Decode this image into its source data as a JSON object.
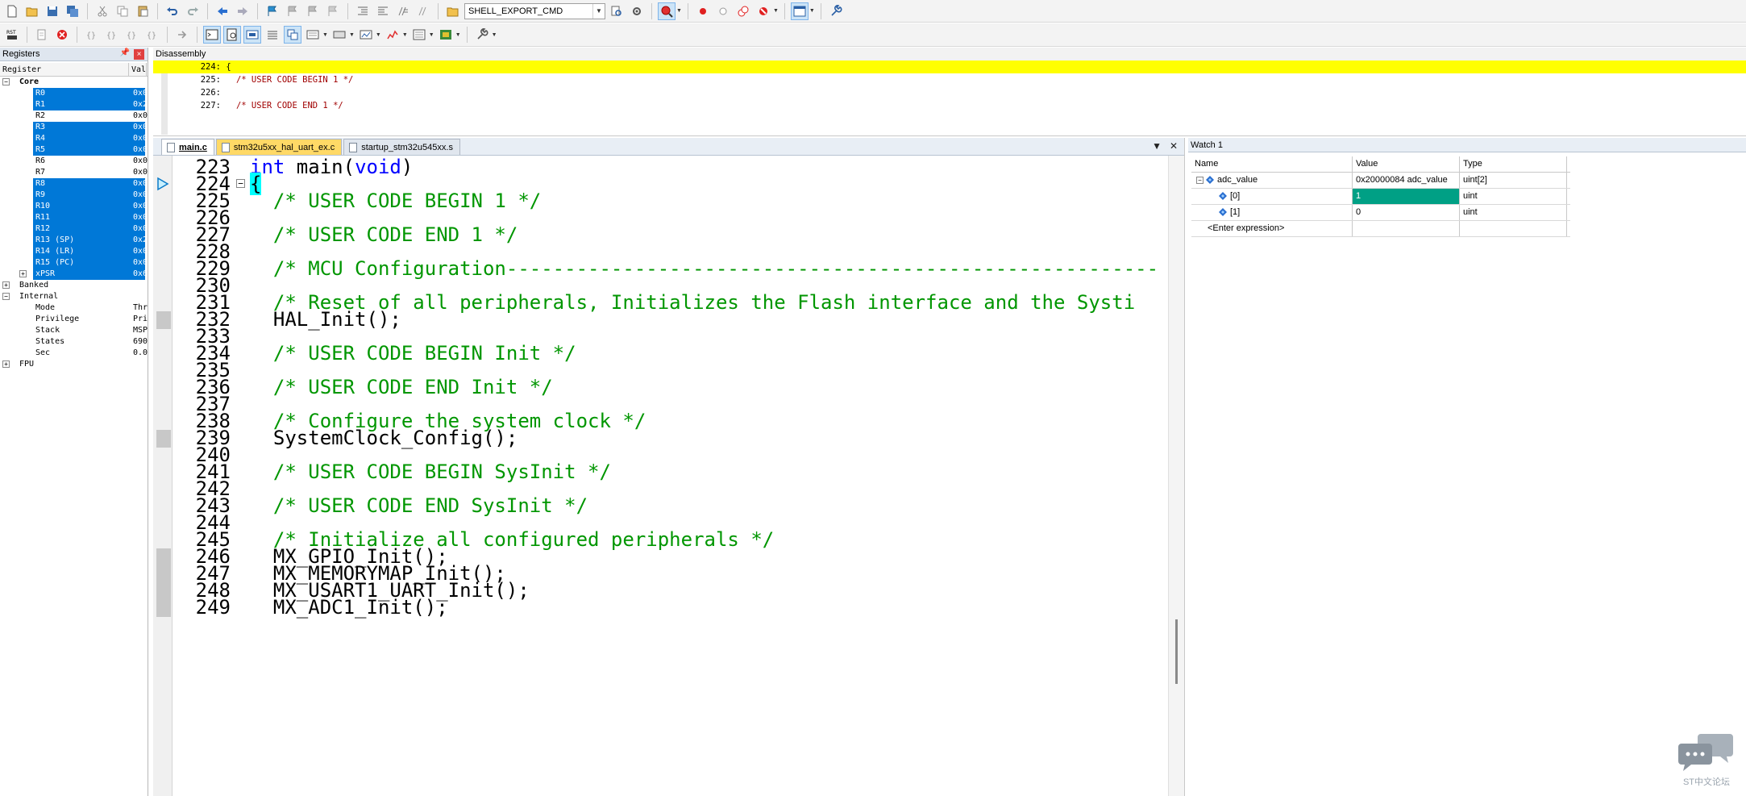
{
  "toolbar": {
    "target_combo": "SHELL_EXPORT_CMD"
  },
  "registers": {
    "title": "Registers",
    "close": "×",
    "col_register": "Register",
    "col_value": "Val",
    "rows": [
      {
        "name": "Core",
        "value": "",
        "indent": 1,
        "expand": "⊟",
        "bold": true,
        "sel": false
      },
      {
        "name": "R0",
        "value": "0x0",
        "indent": 3,
        "sel": true
      },
      {
        "name": "R1",
        "value": "0x2",
        "indent": 3,
        "sel": true
      },
      {
        "name": "R2",
        "value": "0x0",
        "indent": 3,
        "sel": false
      },
      {
        "name": "R3",
        "value": "0x0",
        "indent": 3,
        "sel": true
      },
      {
        "name": "R4",
        "value": "0x0",
        "indent": 3,
        "sel": true
      },
      {
        "name": "R5",
        "value": "0x0",
        "indent": 3,
        "sel": true
      },
      {
        "name": "R6",
        "value": "0x0",
        "indent": 3,
        "sel": false
      },
      {
        "name": "R7",
        "value": "0x0",
        "indent": 3,
        "sel": false
      },
      {
        "name": "R8",
        "value": "0x0",
        "indent": 3,
        "sel": true
      },
      {
        "name": "R9",
        "value": "0x0",
        "indent": 3,
        "sel": true
      },
      {
        "name": "R10",
        "value": "0x0",
        "indent": 3,
        "sel": true
      },
      {
        "name": "R11",
        "value": "0x0",
        "indent": 3,
        "sel": true
      },
      {
        "name": "R12",
        "value": "0x0",
        "indent": 3,
        "sel": true
      },
      {
        "name": "R13 (SP)",
        "value": "0x2",
        "indent": 3,
        "sel": true
      },
      {
        "name": "R14 (LR)",
        "value": "0x0",
        "indent": 3,
        "sel": true
      },
      {
        "name": "R15 (PC)",
        "value": "0x0",
        "indent": 3,
        "sel": true
      },
      {
        "name": "xPSR",
        "value": "0x6",
        "indent": 3,
        "expand": "⊞",
        "sel": true
      },
      {
        "name": "Banked",
        "value": "",
        "indent": 1,
        "expand": "⊞",
        "sel": false
      },
      {
        "name": "Internal",
        "value": "",
        "indent": 1,
        "expand": "⊟",
        "sel": false
      },
      {
        "name": "Mode",
        "value": "Thr",
        "indent": 3,
        "sel": false
      },
      {
        "name": "Privilege",
        "value": "Pri",
        "indent": 3,
        "sel": false
      },
      {
        "name": "Stack",
        "value": "MSP",
        "indent": 3,
        "sel": false
      },
      {
        "name": "States",
        "value": "690",
        "indent": 3,
        "sel": false
      },
      {
        "name": "Sec",
        "value": "0.0",
        "indent": 3,
        "sel": false
      },
      {
        "name": "FPU",
        "value": "",
        "indent": 1,
        "expand": "⊞",
        "sel": false
      }
    ]
  },
  "disassembly": {
    "title": "Disassembly",
    "lines": [
      {
        "num": "224:",
        "text": " {",
        "current": true,
        "comment": false
      },
      {
        "num": "225:",
        "text": "   /* USER CODE BEGIN 1 */",
        "current": false,
        "comment": true
      },
      {
        "num": "226:",
        "text": "",
        "current": false,
        "comment": false
      },
      {
        "num": "227:",
        "text": "   /* USER CODE END 1 */",
        "current": false,
        "comment": true
      }
    ]
  },
  "editor": {
    "tabs": [
      {
        "label": "main.c",
        "active": true,
        "modified": false
      },
      {
        "label": "stm32u5xx_hal_uart_ex.c",
        "active": false,
        "modified": true
      },
      {
        "label": "startup_stm32u545xx.s",
        "active": false,
        "modified": false
      }
    ],
    "lines": [
      {
        "ln": "223",
        "text": "int main(void)",
        "type": "main"
      },
      {
        "ln": "224",
        "text": "{",
        "type": "brace"
      },
      {
        "ln": "225",
        "text": "  /* USER CODE BEGIN 1 */",
        "type": "comment"
      },
      {
        "ln": "226",
        "text": "",
        "type": "plain"
      },
      {
        "ln": "227",
        "text": "  /* USER CODE END 1 */",
        "type": "comment"
      },
      {
        "ln": "228",
        "text": "",
        "type": "plain"
      },
      {
        "ln": "229",
        "text": "  /* MCU Configuration--------------------------------------------------------",
        "type": "comment"
      },
      {
        "ln": "230",
        "text": "",
        "type": "plain"
      },
      {
        "ln": "231",
        "text": "  /* Reset of all peripherals, Initializes the Flash interface and the Systi",
        "type": "comment"
      },
      {
        "ln": "232",
        "text": "  HAL_Init();",
        "type": "plain",
        "bp": true
      },
      {
        "ln": "233",
        "text": "",
        "type": "plain"
      },
      {
        "ln": "234",
        "text": "  /* USER CODE BEGIN Init */",
        "type": "comment"
      },
      {
        "ln": "235",
        "text": "",
        "type": "plain"
      },
      {
        "ln": "236",
        "text": "  /* USER CODE END Init */",
        "type": "comment"
      },
      {
        "ln": "237",
        "text": "",
        "type": "plain"
      },
      {
        "ln": "238",
        "text": "  /* Configure the system clock */",
        "type": "comment"
      },
      {
        "ln": "239",
        "text": "  SystemClock_Config();",
        "type": "plain",
        "bp": true
      },
      {
        "ln": "240",
        "text": "",
        "type": "plain"
      },
      {
        "ln": "241",
        "text": "  /* USER CODE BEGIN SysInit */",
        "type": "comment"
      },
      {
        "ln": "242",
        "text": "",
        "type": "plain"
      },
      {
        "ln": "243",
        "text": "  /* USER CODE END SysInit */",
        "type": "comment"
      },
      {
        "ln": "244",
        "text": "",
        "type": "plain"
      },
      {
        "ln": "245",
        "text": "  /* Initialize all configured peripherals */",
        "type": "comment"
      },
      {
        "ln": "246",
        "text": "  MX_GPIO_Init();",
        "type": "plain",
        "bp": true
      },
      {
        "ln": "247",
        "text": "  MX_MEMORYMAP_Init();",
        "type": "plain",
        "bp": true
      },
      {
        "ln": "248",
        "text": "  MX_USART1_UART_Init();",
        "type": "plain",
        "bp": true
      },
      {
        "ln": "249",
        "text": "  MX_ADC1_Init();",
        "type": "plain",
        "bp": true
      }
    ],
    "main_kw": "int",
    "main_name": " main(",
    "main_kw2": "void",
    "main_close": ")"
  },
  "watch": {
    "title": "Watch 1",
    "col_name": "Name",
    "col_value": "Value",
    "col_type": "Type",
    "rows": [
      {
        "name": "adc_value",
        "value": "0x20000084 adc_value",
        "type": "uint[2]",
        "level": 0,
        "expand": "⊟",
        "edit": false
      },
      {
        "name": "[0]",
        "value": "1",
        "type": "uint",
        "level": 1,
        "expand": "",
        "edit": true
      },
      {
        "name": "[1]",
        "value": "0",
        "type": "uint",
        "level": 1,
        "expand": "",
        "edit": false
      },
      {
        "name": "<Enter expression>",
        "value": "",
        "type": "",
        "level": 0,
        "expand": "",
        "edit": false
      }
    ]
  },
  "watermark": {
    "text": "ST中文论坛"
  }
}
